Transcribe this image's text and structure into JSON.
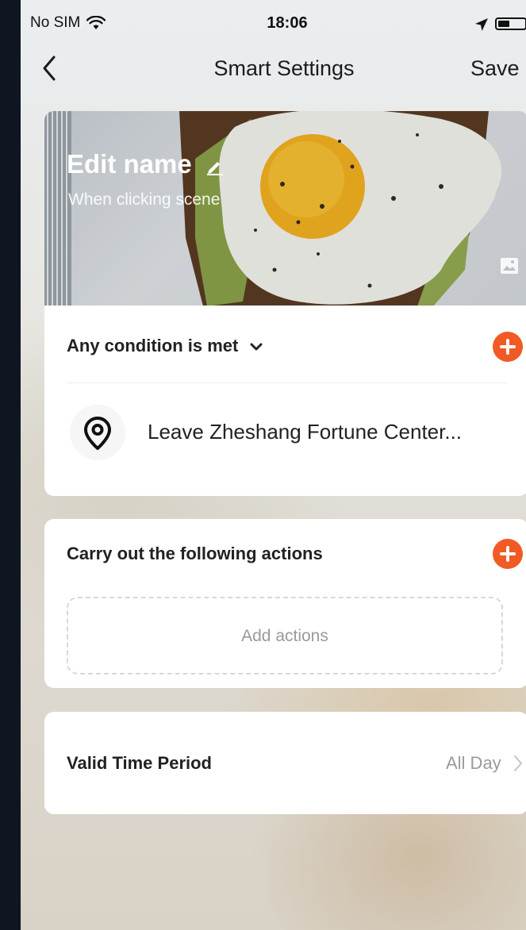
{
  "status_bar": {
    "carrier": "No SIM",
    "time": "18:06"
  },
  "nav": {
    "title": "Smart Settings",
    "save_label": "Save"
  },
  "scene": {
    "name": "Edit name",
    "description": "When clicking  scene"
  },
  "conditions": {
    "title": "Any condition is met",
    "items": [
      {
        "label": "Leave Zheshang Fortune Center...",
        "icon": "location-pin-icon"
      }
    ]
  },
  "actions": {
    "title": "Carry out the following actions",
    "empty_label": "Add actions"
  },
  "valid_time": {
    "title": "Valid Time Period",
    "value": "All Day"
  },
  "colors": {
    "accent": "#f15a24",
    "text": "#222222",
    "muted": "#9a9a9a"
  }
}
